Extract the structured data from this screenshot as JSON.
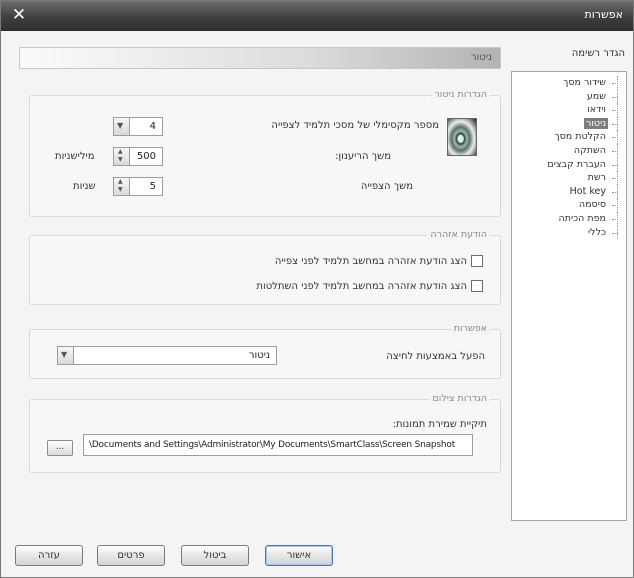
{
  "window": {
    "title": "אפשרות",
    "close_glyph": "✕"
  },
  "tree": {
    "caption": "הגדר רשימה",
    "items": [
      "שידור מסך",
      "שמע",
      "וידאו",
      "ניטור",
      "הקלטת מסך",
      "השתקה",
      "העברת קבצים",
      "רשת",
      "Hot key",
      "סיסמה",
      "מפת הכיתה",
      "כללי"
    ],
    "selected_index": 3
  },
  "section_header": "ניטור",
  "monitor_settings": {
    "legend": "הגדרות ניטור",
    "max_screens_label": "מספר מקסימלי של מסכי תלמיד לצפייה",
    "max_screens_value": "4",
    "refresh_label": "משך הריענון:",
    "refresh_value": "500",
    "refresh_unit": "מילישניות",
    "view_label": "משך הצפייה",
    "view_value": "5",
    "view_unit": "שניות"
  },
  "alert_messages": {
    "legend": "הודעת אזהרה",
    "option1": "הצג הודעת אזהרה במחשב תלמיד לפני צפייה",
    "option2": "הצג הודעת אזהרה במחשב תלמיד לפני השתלטות"
  },
  "options": {
    "legend": "אפשרות",
    "double_click_label": "הפעל באמצעות לחיצה",
    "double_click_value": "ניטור"
  },
  "capture_settings": {
    "legend": "הגדרות צילום",
    "folder_label": "תיקיית שמירת תמונות:",
    "folder_path": "\\Documents and Settings\\Administrator\\My Documents\\SmartClass\\Screen Snapshot",
    "browse_label": "..."
  },
  "buttons": {
    "ok": "אישור",
    "cancel": "ביטול",
    "apply": "פרטים",
    "help": "עזרה"
  }
}
